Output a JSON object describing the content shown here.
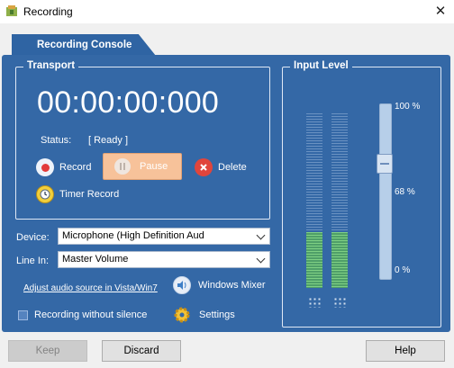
{
  "window": {
    "title": "Recording",
    "close_symbol": "✕"
  },
  "tab": {
    "label": "Recording Console"
  },
  "transport": {
    "title": "Transport",
    "timer": "00:00:00:000",
    "status_label": "Status:",
    "status_value": "[ Ready ]",
    "record_label": "Record",
    "pause_label": "Pause",
    "delete_label": "Delete",
    "timer_record_label": "Timer Record"
  },
  "device": {
    "label": "Device:",
    "value": "Microphone (High Definition Aud"
  },
  "line_in": {
    "label": "Line In:",
    "value": "Master Volume"
  },
  "adjust_link": "Adjust audio source in Vista/Win7",
  "windows_mixer_label": "Windows Mixer",
  "recording_without_silence": {
    "label": "Recording without silence",
    "checked": false
  },
  "settings_label": "Settings",
  "input_level": {
    "title": "Input Level",
    "ticks": [
      "100 %",
      "68 %",
      "0 %"
    ],
    "meter_levels": [
      0.32,
      0.32
    ],
    "slider_value_percent": 68
  },
  "buttons": {
    "keep": "Keep",
    "discard": "Discard",
    "help": "Help"
  },
  "colors": {
    "panel": "#3468a6",
    "pause_bg": "#f7c29a",
    "meter_green": "#7fd084"
  }
}
